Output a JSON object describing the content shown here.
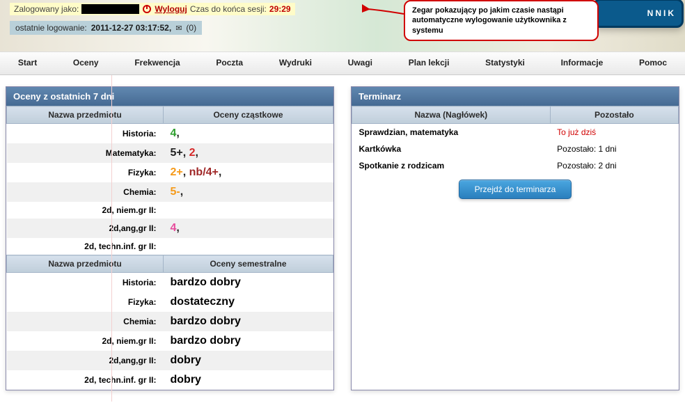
{
  "header": {
    "logged_as_label": "Zalogowany jako:",
    "logout_label": "Wyloguj",
    "session_label": "Czas do końca sesji:",
    "session_time": "29:29",
    "last_login_label": "ostatnie logowanie:",
    "last_login_value": "2011-12-27 03:17:52,",
    "mail_count": "(0)",
    "logo_text": "NNIK"
  },
  "callout_text": "Zegar pokazujący po jakim czasie nastąpi automatyczne wylogowanie użytkownika z systemu",
  "menu": [
    "Start",
    "Oceny",
    "Frekwencja",
    "Poczta",
    "Wydruki",
    "Uwagi",
    "Plan lekcji",
    "Statystyki",
    "Informacje",
    "Pomoc"
  ],
  "left_box": {
    "title": "Oceny z ostatnich 7 dni",
    "headers1": [
      "Nazwa przedmiotu",
      "Oceny cząstkowe"
    ],
    "grades": [
      {
        "subject": "Historia:",
        "marks": [
          {
            "t": "4",
            "c": "g-green"
          }
        ],
        "alt": false
      },
      {
        "subject": "Matematyka:",
        "marks": [
          {
            "t": "5+",
            "c": "g-black"
          },
          {
            "t": "2",
            "c": "g-red"
          }
        ],
        "alt": true
      },
      {
        "subject": "Fizyka:",
        "marks": [
          {
            "t": "2+",
            "c": "g-orange"
          },
          {
            "t": "nb/4+",
            "c": "g-maroon"
          }
        ],
        "alt": false
      },
      {
        "subject": "Chemia:",
        "marks": [
          {
            "t": "5-",
            "c": "g-orange"
          }
        ],
        "alt": true
      },
      {
        "subject": "2d, niem.gr II:",
        "marks": [],
        "alt": false
      },
      {
        "subject": "2d,ang,gr II:",
        "marks": [
          {
            "t": "4",
            "c": "g-pink"
          }
        ],
        "alt": true
      },
      {
        "subject": "2d, techn.inf. gr II:",
        "marks": [],
        "alt": false
      }
    ],
    "headers2": [
      "Nazwa przedmiotu",
      "Oceny semestralne"
    ],
    "semester": [
      {
        "subject": "Historia:",
        "value": "bardzo dobry",
        "alt": false
      },
      {
        "subject": "Fizyka:",
        "value": "dostateczny",
        "alt": false
      },
      {
        "subject": "Chemia:",
        "value": "bardzo dobry",
        "alt": true
      },
      {
        "subject": "2d, niem.gr II:",
        "value": "bardzo dobry",
        "alt": false
      },
      {
        "subject": "2d,ang,gr II:",
        "value": "dobry",
        "alt": true
      },
      {
        "subject": "2d, techn.inf. gr II:",
        "value": "dobry",
        "alt": false
      }
    ]
  },
  "right_box": {
    "title": "Terminarz",
    "headers": [
      "Nazwa (Nagłówek)",
      "Pozostało"
    ],
    "items": [
      {
        "name": "Sprawdzian, matematyka",
        "remain": "To już dziś",
        "red": true
      },
      {
        "name": "Kartkówka",
        "remain": "Pozostało: 1 dni",
        "red": false
      },
      {
        "name": "Spotkanie z rodzicam",
        "remain": "Pozostało: 2 dni",
        "red": false
      }
    ],
    "button": "Przejdź do terminarza"
  }
}
